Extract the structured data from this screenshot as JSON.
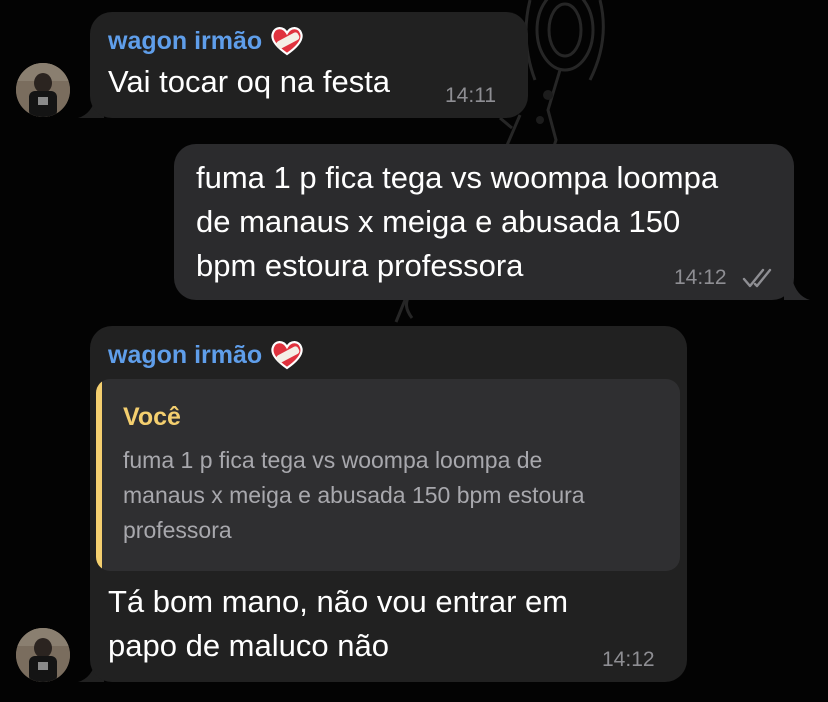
{
  "messages": [
    {
      "sender": "wagon irmão",
      "sender_emoji": "heart-with-bandage-icon",
      "text": "Vai tocar oq na festa",
      "time": "14:11",
      "direction": "incoming"
    },
    {
      "text_lines": [
        "fuma 1 p fica tega vs woompa loompa",
        "de manaus x meiga e abusada 150",
        "bpm estoura professora"
      ],
      "time": "14:12",
      "direction": "outgoing",
      "status": "read-double-check-icon"
    },
    {
      "sender": "wagon irmão",
      "sender_emoji": "heart-with-bandage-icon",
      "reply": {
        "author": "Você",
        "text_lines": [
          "fuma 1 p fica tega vs woompa loompa de",
          "manaus x meiga e abusada 150 bpm estoura",
          "professora"
        ]
      },
      "text_lines": [
        "Tá bom mano, não vou entrar em",
        "papo de maluco não"
      ],
      "time": "14:12",
      "direction": "incoming"
    }
  ],
  "colors": {
    "sender_name": "#5f9eea",
    "reply_accent": "#f4cf6f",
    "bubble_incoming": "#212121",
    "bubble_outgoing": "#2b2b2d",
    "timestamp": "#8e8e93"
  }
}
